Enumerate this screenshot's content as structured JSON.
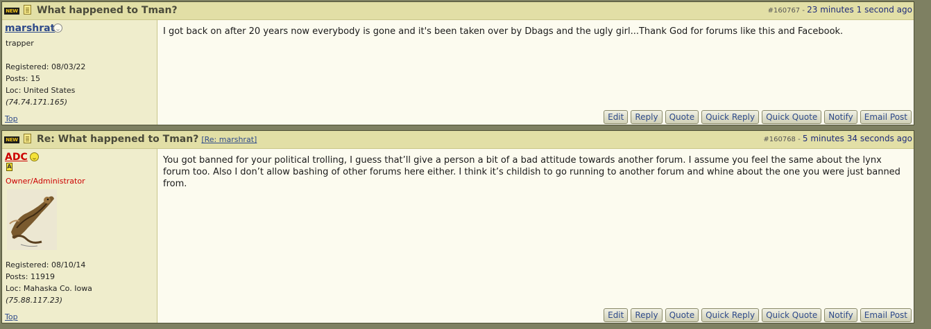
{
  "posts": [
    {
      "subject": "What happened to Tman?",
      "post_number": "#160767",
      "meta_separator": " - ",
      "timestamp": "23 minutes 1 second ago",
      "author": {
        "username": "marshrat",
        "status_icon": "offline-status-icon",
        "title": "trapper",
        "registered": "Registered: 08/03/22",
        "posts": "Posts: 15",
        "location": "Loc: United States",
        "ip": "(74.74.171.165)"
      },
      "top_link": "Top",
      "message": "I got back on after 20 years now everybody is gone and it's been taken over by Dbags and the ugly girl...Thank God for forums like this and Facebook."
    },
    {
      "subject": "Re: What happened to Tman?",
      "reply_ref": "[Re: marshrat]",
      "post_number": "#160768",
      "meta_separator": " - ",
      "timestamp": "5 minutes 34 seconds ago",
      "author": {
        "username": "ADC",
        "status_icon": "online-status-icon",
        "badge": "A",
        "title": "Owner/Administrator",
        "registered": "Registered: 08/10/14",
        "posts": "Posts: 11919",
        "location": "Loc: Mahaska Co. Iowa",
        "ip": "(75.88.117.23)"
      },
      "top_link": "Top",
      "message": "You got banned for your political trolling, I guess that’ll give a person a bit of a bad attitude towards another forum. I assume you feel the same about the lynx forum too. Also I don’t allow bashing of other forums here either. I think it’s childish to go running to another forum and whine about the one you were just banned from."
    }
  ],
  "badge_new": "NEW",
  "actions": [
    "Edit",
    "Reply",
    "Quote",
    "Quick Reply",
    "Quick Quote",
    "Notify",
    "Email Post"
  ],
  "colors": {
    "page_background": "#7e8062",
    "header_background": "#e2dfa6",
    "link": "#2e4a8a",
    "admin_name": "#cc0000"
  }
}
